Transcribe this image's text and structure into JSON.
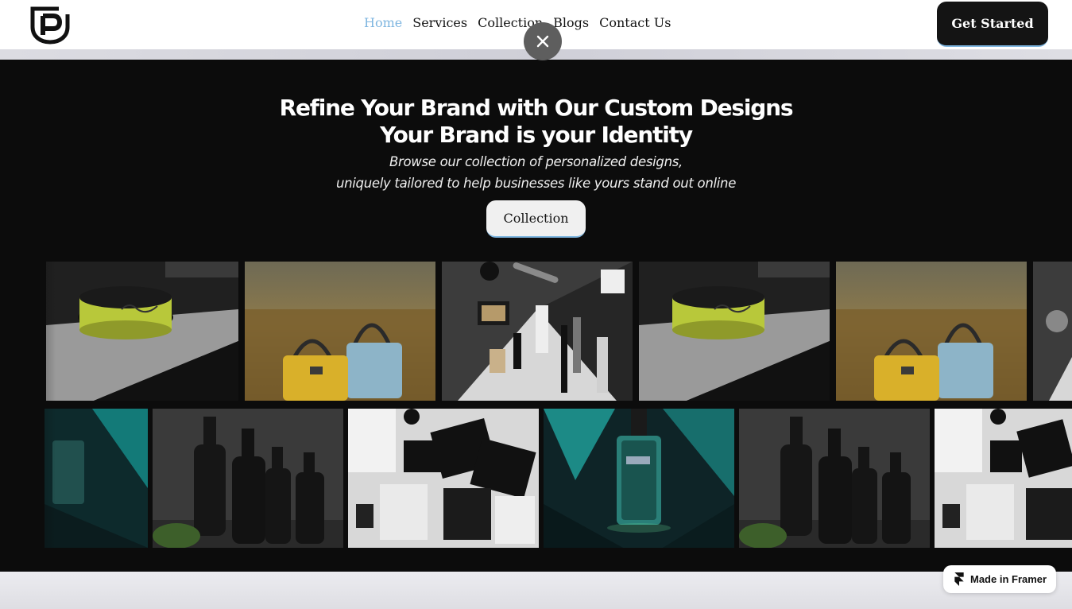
{
  "nav": {
    "links": [
      "Home",
      "Services",
      "Collection",
      "Blogs",
      "Contact Us"
    ],
    "active": "Home",
    "cta_label": "Get Started"
  },
  "hero": {
    "title_line1": "Refine Your Brand with Our Custom Designs",
    "title_line2": "Your Brand is your Identity",
    "subtitle_line1": "Browse our collection of personalized designs,",
    "subtitle_line2": "uniquely tailored to help businesses like yours stand out online",
    "button_label": "Collection"
  },
  "gallery": {
    "row1": [
      "green-jar-image",
      "handbag-field-image",
      "cosmetics-flatlay-image",
      "green-jar-image",
      "handbag-field-image",
      "cosmetics-flatlay-image"
    ],
    "row2": [
      "perfume-bottle-image",
      "black-bottles-image",
      "apparel-flatlay-image",
      "perfume-bottle-image",
      "black-bottles-image",
      "apparel-flatlay-image"
    ]
  },
  "badge": {
    "label": "Made in Framer"
  },
  "colors": {
    "accent": "#7fb6e0",
    "hero_bg": "#0c0c0c",
    "dark": "#141414"
  },
  "icons": {
    "logo": "shield-p-logo-icon",
    "close": "close-icon",
    "framer": "framer-icon"
  }
}
